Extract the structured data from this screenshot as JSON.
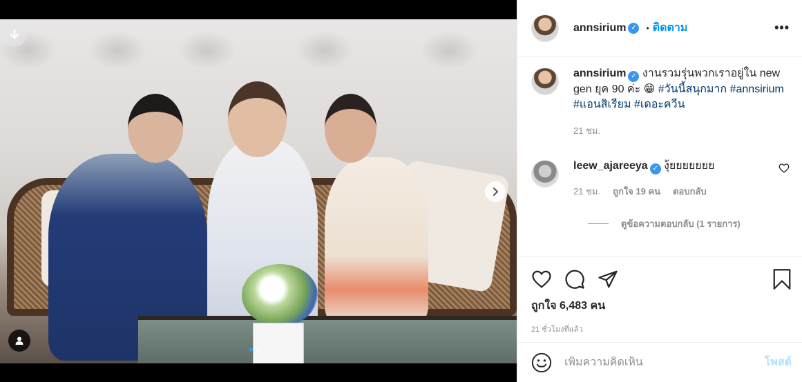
{
  "post": {
    "username": "annsirium",
    "follow_label": "ติดตาม",
    "bullet": "•",
    "more_label": "•••"
  },
  "caption": {
    "username": "annsirium",
    "text_plain": " งานรวมรุ่นพวกเราอยู่ใน new gen ยุค 90 ค่ะ 😁 ",
    "hashtags": [
      "#วันนี้สนุกมาก",
      "#annsirium",
      "#แอนสิเรียม",
      "#เดอะควีน"
    ],
    "time": "21 ชม."
  },
  "comments": [
    {
      "username": "leew_ajareeya",
      "text": " งุ้ยยยยยยย",
      "time": "21 ชม.",
      "likes": "ถูกใจ 19 คน",
      "reply_label": "ตอบกลับ",
      "view_replies": "ดูข้อความตอบกลับ (1 รายการ)"
    }
  ],
  "likes_text": "ถูกใจ 6,483 คน",
  "post_time": "21 ชั่วโมงที่แล้ว",
  "add_comment": {
    "placeholder": "เพิ่มความคิดเห็น",
    "post_label": "โพสต์"
  },
  "icons": {
    "download": "download-icon",
    "next": "chevron-right-icon",
    "tag": "user-tag-icon",
    "like": "heart-icon",
    "comment": "comment-icon",
    "share": "share-icon",
    "save": "bookmark-icon",
    "emoji": "emoji-icon",
    "verified": "verified-badge-icon"
  },
  "colors": {
    "accent": "#0095f6",
    "hashtag": "#00376b",
    "muted": "#8e8e8e",
    "post_disabled": "#b2dffc"
  },
  "carousel": {
    "dots": 2,
    "active_index": 0
  }
}
